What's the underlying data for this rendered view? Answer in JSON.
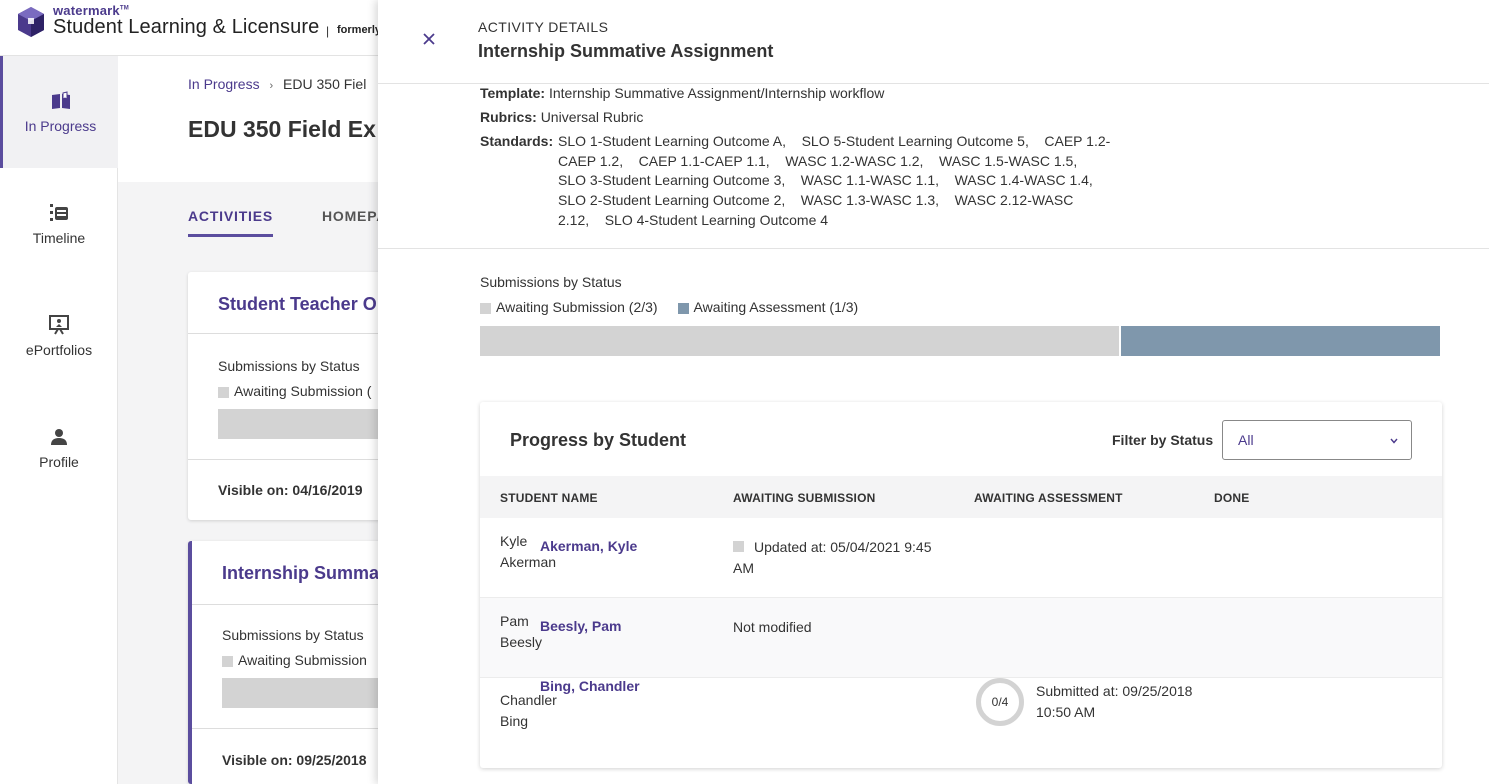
{
  "header": {
    "brand_small": "watermark",
    "brand_title": "Student Learning & Licensure",
    "separator": "|",
    "formerly": "formerly"
  },
  "nav": {
    "items": [
      {
        "label": "In Progress",
        "icon": "book-open-icon",
        "active": true
      },
      {
        "label": "Timeline",
        "icon": "timeline-icon",
        "active": false
      },
      {
        "label": "ePortfolios",
        "icon": "presentation-icon",
        "active": false
      },
      {
        "label": "Profile",
        "icon": "person-icon",
        "active": false
      }
    ]
  },
  "background": {
    "breadcrumb": {
      "link": "In Progress",
      "sep": "›",
      "current": "EDU 350 Fiel"
    },
    "title": "EDU 350 Field Ex",
    "tabs": [
      "ACTIVITIES",
      "HOMEPA"
    ],
    "cards": [
      {
        "title": "Student Teacher O",
        "sub": "Submissions by Status",
        "legend": "Awaiting Submission (",
        "visible": "Visible on: 04/16/2019"
      },
      {
        "title": "Internship Summa",
        "sub": "Submissions by Status",
        "legend": "Awaiting Submission",
        "visible": "Visible on: 09/25/2018"
      }
    ]
  },
  "drawer": {
    "kicker": "ACTIVITY DETAILS",
    "title": "Internship Summative Assignment",
    "template_label": "Template:",
    "template_value": "Internship Summative Assignment/Internship workflow",
    "rubrics_label": "Rubrics:",
    "rubrics_value": "Universal Rubric",
    "standards_label": "Standards:",
    "standards_value": "SLO 1-Student Learning Outcome A,    SLO 5-Student Learning Outcome 5,    CAEP 1.2-CAEP 1.2,    CAEP 1.1-CAEP 1.1,    WASC 1.2-WASC 1.2,    WASC 1.5-WASC 1.5,    SLO 3-Student Learning Outcome 3,    WASC 1.1-WASC 1.1,    WASC 1.4-WASC 1.4,    SLO 2-Student Learning Outcome 2,    WASC 1.3-WASC 1.3,    WASC 2.12-WASC 2.12,    SLO 4-Student Learning Outcome 4",
    "submissions": {
      "title": "Submissions by Status",
      "legend": [
        {
          "label": "Awaiting Submission (2/3)",
          "color": "#d3d3d3",
          "fraction": 0.667
        },
        {
          "label": "Awaiting Assessment (1/3)",
          "color": "#7f97ac",
          "fraction": 0.333
        }
      ]
    },
    "progress": {
      "title": "Progress by Student",
      "filter_label": "Filter by Status",
      "filter_value": "All",
      "columns": [
        "STUDENT NAME",
        "AWAITING SUBMISSION",
        "AWAITING ASSESSMENT",
        "DONE"
      ],
      "rows": [
        {
          "first": "Kyle",
          "last": "Akerman",
          "name": "Akerman, Kyle",
          "awaiting_submission": "Updated at: 05/04/2021 9:45 AM",
          "awaiting_assessment": "",
          "done": ""
        },
        {
          "first": "Pam",
          "last": "Beesly",
          "name": "Beesly, Pam",
          "awaiting_submission": "Not modified",
          "awaiting_assessment": "",
          "done": ""
        },
        {
          "first": "Chandler",
          "last": "Bing",
          "name": "Bing, Chandler",
          "awaiting_submission": "",
          "awaiting_assessment": "Submitted at: 09/25/2018 10:50 AM",
          "ring": "0/4",
          "done": ""
        }
      ]
    }
  }
}
